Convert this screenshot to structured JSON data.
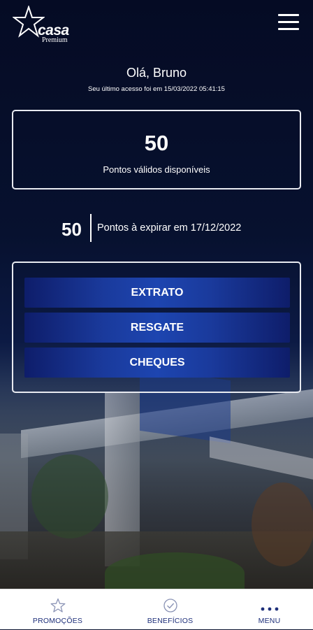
{
  "brand": {
    "name": "casa",
    "subtitle": "Premium"
  },
  "header": {
    "menu_icon": "hamburger-icon"
  },
  "user": {
    "greeting": "Olá, Bruno",
    "last_access": "Seu último acesso foi em 15/03/2022 05:41:15"
  },
  "points": {
    "value": "50",
    "label": "Pontos válidos disponíveis"
  },
  "expiring": {
    "value": "50",
    "label": "Pontos à expirar em 17/12/2022"
  },
  "actions": [
    {
      "label": "EXTRATO"
    },
    {
      "label": "RESGATE"
    },
    {
      "label": "CHEQUES"
    }
  ],
  "tabbar": [
    {
      "label": "PROMOÇÕES",
      "icon": "star-outline-icon"
    },
    {
      "label": "BENEFÍCIOS",
      "icon": "check-circle-icon"
    },
    {
      "label": "MENU",
      "icon": "more-dots-icon"
    }
  ],
  "colors": {
    "background": "#07112f",
    "button": "#1a3a9c",
    "tab_label": "#1e2f7a"
  }
}
